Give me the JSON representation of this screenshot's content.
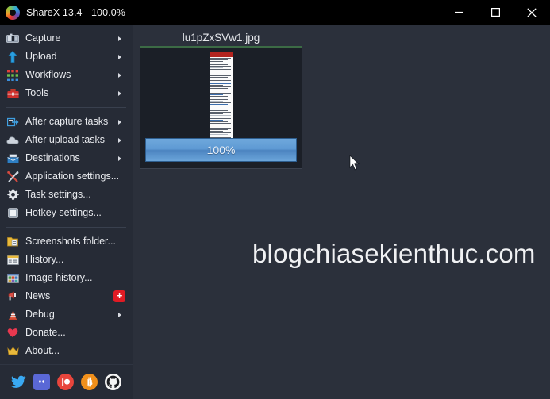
{
  "window": {
    "title": "ShareX 13.4 - 100.0%",
    "logo_icon": "sharex-logo-icon",
    "controls": {
      "minimize_label": "Minimize",
      "maximize_label": "Maximize",
      "close_label": "Close"
    }
  },
  "menu": {
    "groups": [
      {
        "items": [
          {
            "label": "Capture",
            "icon": "camera-icon",
            "submenu": true
          },
          {
            "label": "Upload",
            "icon": "upload-arrow-icon",
            "submenu": true
          },
          {
            "label": "Workflows",
            "icon": "workflows-grid-icon",
            "submenu": true
          },
          {
            "label": "Tools",
            "icon": "toolbox-icon",
            "submenu": true
          }
        ]
      },
      {
        "items": [
          {
            "label": "After capture tasks",
            "icon": "after-capture-icon",
            "submenu": true
          },
          {
            "label": "After upload tasks",
            "icon": "cloud-icon",
            "submenu": true
          },
          {
            "label": "Destinations",
            "icon": "destinations-icon",
            "submenu": true
          },
          {
            "label": "Application settings...",
            "icon": "tools-cross-icon",
            "submenu": false
          },
          {
            "label": "Task settings...",
            "icon": "gear-icon",
            "submenu": false
          },
          {
            "label": "Hotkey settings...",
            "icon": "keyboard-key-icon",
            "submenu": false
          }
        ]
      },
      {
        "items": [
          {
            "label": "Screenshots folder...",
            "icon": "folder-icon",
            "submenu": false
          },
          {
            "label": "History...",
            "icon": "history-icon",
            "submenu": false
          },
          {
            "label": "Image history...",
            "icon": "image-history-icon",
            "submenu": false
          },
          {
            "label": "News",
            "icon": "megaphone-icon",
            "submenu": false,
            "badge": "+"
          },
          {
            "label": "Debug",
            "icon": "traffic-cone-icon",
            "submenu": true
          },
          {
            "label": "Donate...",
            "icon": "heart-icon",
            "submenu": false
          },
          {
            "label": "About...",
            "icon": "crown-icon",
            "submenu": false
          }
        ]
      }
    ],
    "social": [
      {
        "name": "twitter-icon",
        "color": "#39a9f2"
      },
      {
        "name": "discord-icon",
        "color": "#5a68d6"
      },
      {
        "name": "patreon-icon",
        "color": "#e8453c"
      },
      {
        "name": "bitcoin-icon",
        "color": "#f1901b"
      },
      {
        "name": "github-icon",
        "color": "#f4f4f4"
      }
    ]
  },
  "task": {
    "filename": "lu1pZxSVw1.jpg",
    "progress_label": "100%",
    "progress_percent": 100,
    "status_color": "#3c6b45"
  },
  "watermark": {
    "text": "blogchiasekienthuc.com"
  }
}
